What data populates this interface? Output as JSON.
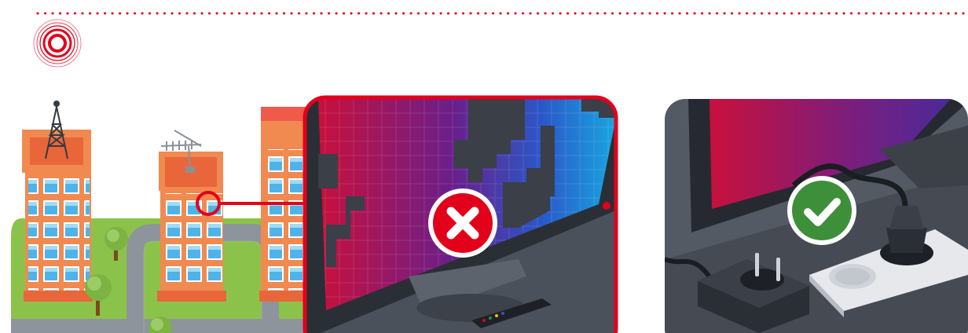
{
  "colors": {
    "accent_red": "#e3001b",
    "success_green": "#3e8f3a",
    "building_orange": "#f08a50",
    "window_blue": "#4fb3e8",
    "grass": "#8bc34a",
    "road": "#8e949c",
    "screen_gradient": [
      "#c8103c",
      "#6a1f8a",
      "#2a57c8",
      "#19a6e0"
    ]
  },
  "icons": {
    "signal": "concentric-circles-icon",
    "tower": "transmission-tower-icon",
    "antenna": "rooftop-antenna-icon",
    "error": "x-mark-icon",
    "success": "checkmark-icon"
  },
  "panels": {
    "left": {
      "status": "error"
    },
    "right": {
      "status": "success"
    }
  }
}
